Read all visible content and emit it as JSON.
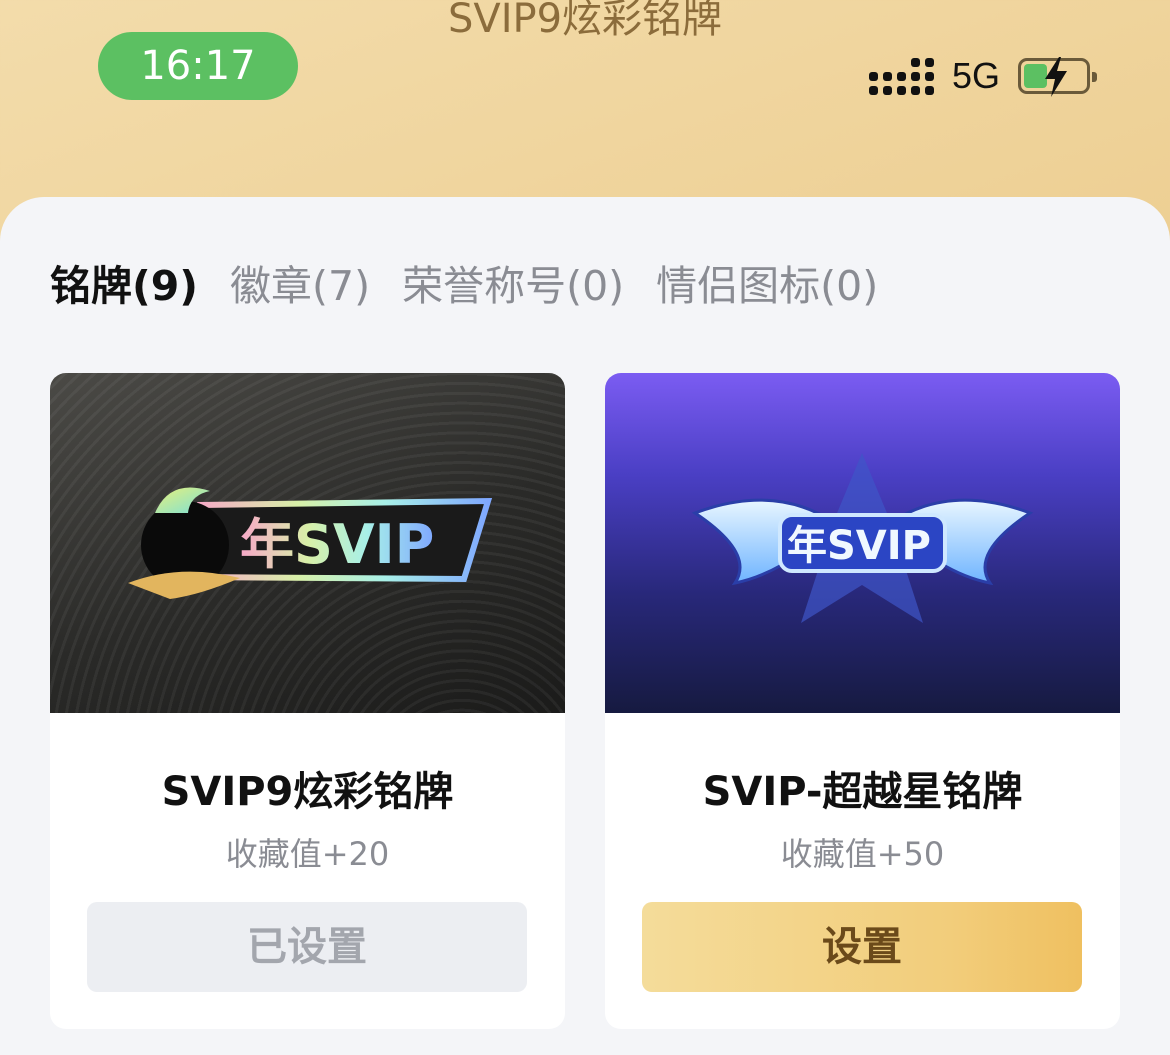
{
  "header": {
    "title": "SVIP9炫彩铭牌"
  },
  "status_bar": {
    "time": "16:17",
    "network": "5G",
    "colors": {
      "time_pill": "#5cc062",
      "battery_fill": "#5cc062"
    }
  },
  "tabs": [
    {
      "label": "铭牌(9)",
      "active": true
    },
    {
      "label": "徽章(7)",
      "active": false
    },
    {
      "label": "荣誉称号(0)",
      "active": false
    },
    {
      "label": "情侣图标(0)",
      "active": false
    }
  ],
  "cards": [
    {
      "badge_text": "年SVIP",
      "title": "SVIP9炫彩铭牌",
      "subtitle": "收藏值+20",
      "button_label": "已设置"
    },
    {
      "badge_text": "年SVIP",
      "title": "SVIP-超越星铭牌",
      "subtitle": "收藏值+50",
      "button_label": "设置"
    }
  ],
  "colors": {
    "accent_gold": "#f2cd7b",
    "button_text_gold": "#6b4a1a"
  }
}
